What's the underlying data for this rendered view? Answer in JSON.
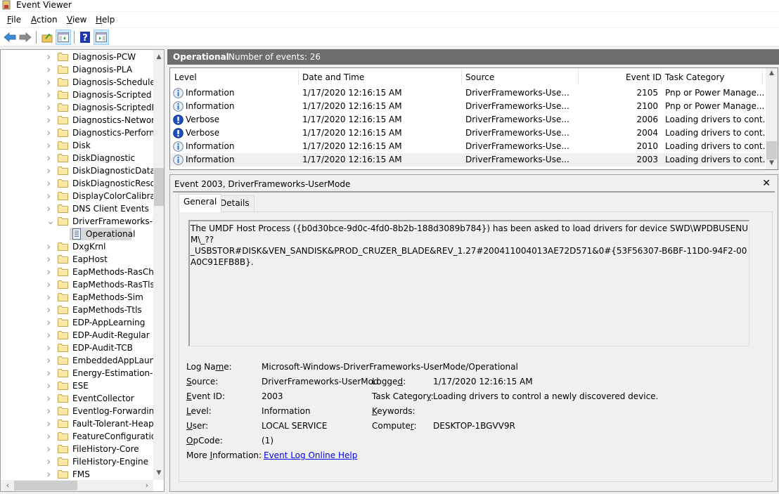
{
  "window": {
    "title": "Event Viewer"
  },
  "menu": {
    "items": [
      {
        "label": "File",
        "accel": "F",
        "rest": "ile"
      },
      {
        "label": "Action",
        "accel": "A",
        "rest": "ction"
      },
      {
        "label": "View",
        "accel": "V",
        "rest": "iew"
      },
      {
        "label": "Help",
        "accel": "H",
        "rest": "elp"
      }
    ]
  },
  "toolbar": {
    "buttons": [
      "back-icon",
      "forward-icon",
      "up-folder-icon",
      "show-hide-console-tree-icon",
      "help-icon",
      "show-hide-action-pane-icon"
    ]
  },
  "tree": {
    "items": [
      "Diagnosis-PCW",
      "Diagnosis-PLA",
      "Diagnosis-Scheduled",
      "Diagnosis-Scripted",
      "Diagnosis-ScriptedDia",
      "Diagnostics-Networki",
      "Diagnostics-Performa",
      "Disk",
      "DiskDiagnostic",
      "DiskDiagnosticDataCo",
      "DiskDiagnosticResolv",
      "DisplayColorCalibratic",
      "DNS Client Events",
      "DriverFrameworks-Us",
      "Operational",
      "DxgKrnl",
      "EapHost",
      "EapMethods-RasChap",
      "EapMethods-RasTls",
      "EapMethods-Sim",
      "EapMethods-Ttls",
      "EDP-AppLearning",
      "EDP-Audit-Regular",
      "EDP-Audit-TCB",
      "EmbeddedAppLaunch",
      "Energy-Estimation-En",
      "ESE",
      "EventCollector",
      "Eventlog-ForwardingP",
      "Fault-Tolerant-Heap",
      "FeatureConfiguration",
      "FileHistory-Core",
      "FileHistory-Engine",
      "FMS"
    ],
    "expanded": "DriverFrameworks-Us",
    "selected": "Operational"
  },
  "log": {
    "name": "Operational",
    "count_label": "Number of events: 26"
  },
  "table": {
    "columns": [
      "Level",
      "Date and Time",
      "Source",
      "Event ID",
      "Task Category"
    ],
    "rows": [
      {
        "level": "Information",
        "icon": "info-icon",
        "datetime": "1/17/2020 12:16:15 AM",
        "source": "DriverFrameworks-Use...",
        "event_id": "2105",
        "task": "Pnp or Power Manage..."
      },
      {
        "level": "Information",
        "icon": "info-icon",
        "datetime": "1/17/2020 12:16:15 AM",
        "source": "DriverFrameworks-Use...",
        "event_id": "2100",
        "task": "Pnp or Power Manage..."
      },
      {
        "level": "Verbose",
        "icon": "verbose-icon",
        "datetime": "1/17/2020 12:16:15 AM",
        "source": "DriverFrameworks-Use...",
        "event_id": "2006",
        "task": "Loading drivers to cont..."
      },
      {
        "level": "Verbose",
        "icon": "verbose-icon",
        "datetime": "1/17/2020 12:16:15 AM",
        "source": "DriverFrameworks-Use...",
        "event_id": "2004",
        "task": "Loading drivers to cont..."
      },
      {
        "level": "Information",
        "icon": "info-icon",
        "datetime": "1/17/2020 12:16:15 AM",
        "source": "DriverFrameworks-Use...",
        "event_id": "2010",
        "task": "Loading drivers to cont..."
      },
      {
        "level": "Information",
        "icon": "info-icon",
        "datetime": "1/17/2020 12:16:15 AM",
        "source": "DriverFrameworks-Use...",
        "event_id": "2003",
        "task": "Loading drivers to cont..."
      }
    ],
    "selected_row": 5
  },
  "detail": {
    "title": "Event 2003, DriverFrameworks-UserMode",
    "tabs": [
      "General",
      "Details"
    ],
    "active_tab": "General",
    "description": "The UMDF Host Process ({b0d30bce-9d0c-4fd0-8b2b-188d3089b784}) has been asked to load drivers for device SWD\\WPDBUSENUM\\_??_USBSTOR#DISK&VEN_SANDISK&PROD_CRUZER_BLADE&REV_1.27#200411004013AE72D571&0#{53F56307-B6BF-11D0-94F2-00A0C91EFB8B}.",
    "description_line1": "The UMDF Host Process ({b0d30bce-9d0c-4fd0-8b2b-188d3089b784}) has been asked to load drivers for device SWD\\WPDBUSENUM\\_??",
    "description_line2": "_USBSTOR#DISK&VEN_SANDISK&PROD_CRUZER_BLADE&REV_1.27#200411004013AE72D571&0#{53F56307-B6BF-11D0-94F2-00A0C91EFB8B}.",
    "fields": {
      "log_name_label": "Log Name:",
      "log_name": "Microsoft-Windows-DriverFrameworks-UserMode/Operational",
      "source_label": "Source:",
      "source": "DriverFrameworks-UserMod",
      "logged_label": "Logged:",
      "logged": "1/17/2020 12:16:15 AM",
      "event_id_label": "Event ID:",
      "event_id": "2003",
      "task_category_label": "Task Category:",
      "task_category": "Loading drivers to control a newly discovered device.",
      "level_label": "Level:",
      "level": "Information",
      "keywords_label": "Keywords:",
      "keywords": "",
      "user_label": "User:",
      "user": "LOCAL SERVICE",
      "computer_label": "Computer:",
      "computer": "DESKTOP-1BGVV9R",
      "opcode_label": "OpCode:",
      "opcode": "(1)",
      "more_info_label": "More Information:",
      "more_info_link": "Event Log Online Help"
    }
  },
  "colors": {
    "header_bg": "#6d6d6d",
    "selection_bg": "#d9d9d9",
    "toolbar_active": "#cce8ff",
    "link": "#0000ee",
    "info_icon": "#2b79d7",
    "verbose_icon": "#1b4fbf"
  }
}
